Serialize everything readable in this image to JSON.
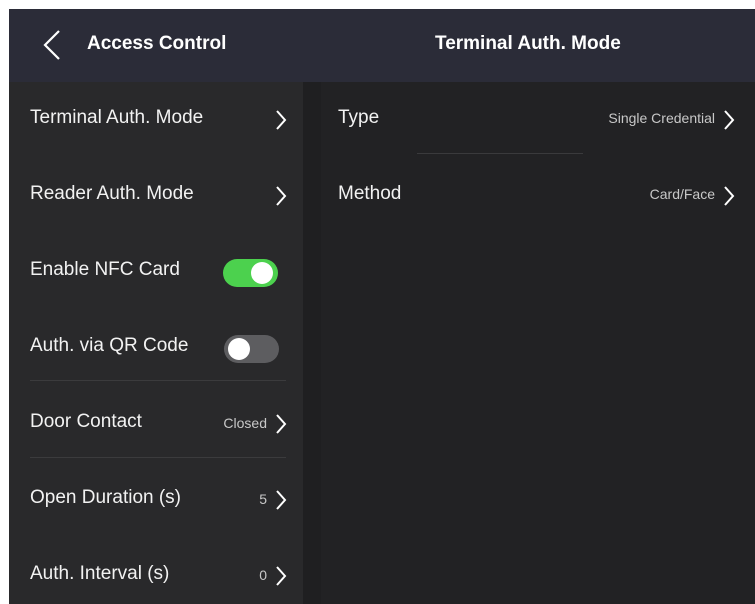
{
  "header": {
    "back_label": "Access Control",
    "page_title": "Terminal Auth. Mode"
  },
  "sidebar": {
    "items": [
      {
        "label": "Terminal Auth. Mode",
        "value": ""
      },
      {
        "label": "Reader Auth. Mode",
        "value": ""
      },
      {
        "label": "Enable NFC Card",
        "toggle": "on"
      },
      {
        "label": "Auth. via QR Code",
        "toggle": "off"
      },
      {
        "label": "Door Contact",
        "value": "Closed"
      },
      {
        "label": "Open Duration (s)",
        "value": "5"
      },
      {
        "label": "Auth. Interval (s)",
        "value": "0"
      }
    ]
  },
  "main": {
    "rows": [
      {
        "label": "Type",
        "value": "Single Credential"
      },
      {
        "label": "Method",
        "value": "Card/Face"
      }
    ]
  },
  "colors": {
    "header_bg": "#2b2c38",
    "sidebar_bg": "#29292b",
    "main_bg": "#222224",
    "toggle_on": "#4cd14e",
    "toggle_off": "#5d5d60"
  },
  "icons": [
    "back-chevron-icon",
    "chevron-right-icon"
  ]
}
